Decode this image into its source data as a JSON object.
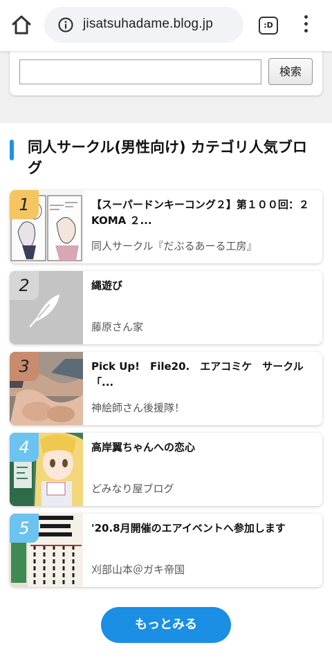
{
  "browser": {
    "url": "jisatsuhadame.blog.jp",
    "tab_icon_label": ":D"
  },
  "search": {
    "input_value": "",
    "button_label": "検索"
  },
  "ranking": {
    "title": "同人サークル(男性向け) カテゴリ人気ブログ",
    "accent_color": "#1e90e6",
    "items": [
      {
        "rank": "1",
        "title": "【スーパードンキーコング２】第１００回：２KOMA ２...",
        "blog": "同人サークル『だぶるあーる工房』",
        "badge_color": "#f4c560"
      },
      {
        "rank": "2",
        "title": "縄遊び",
        "blog": "藤原さん家",
        "badge_color": "#d6d6d6"
      },
      {
        "rank": "3",
        "title": "Pick Up!　File20.　エアコミケ　サークル「...",
        "blog": "神絵師さん後援隊！",
        "badge_color": "#c98a6e"
      },
      {
        "rank": "4",
        "title": "高岸翼ちゃんへの恋心",
        "blog": "どみなり屋ブログ",
        "badge_color": "#6cc3f0"
      },
      {
        "rank": "5",
        "title": "'20.8月開催のエアイベントへ参加します",
        "blog": "刈部山本＠ガキ帝国",
        "badge_color": "#6cc3f0"
      }
    ],
    "more_label": "もっとみる"
  }
}
